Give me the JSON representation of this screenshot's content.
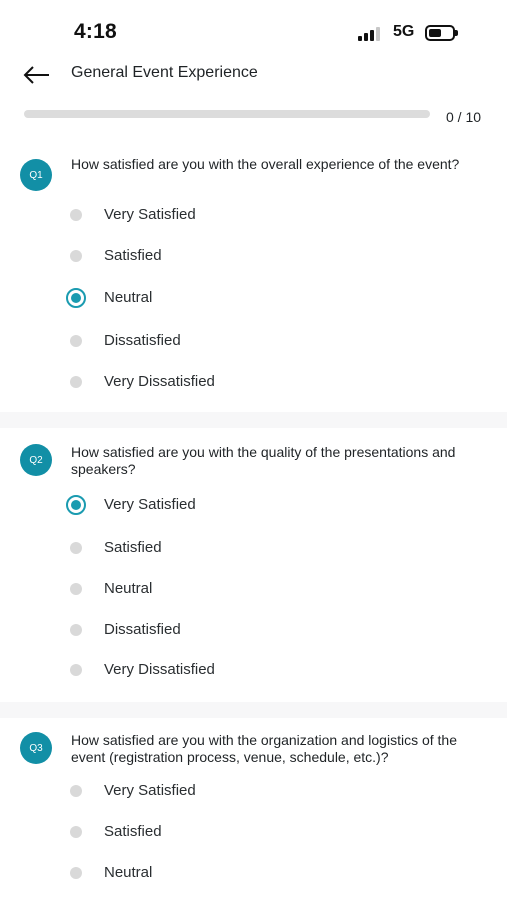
{
  "status_bar": {
    "time": "4:18",
    "network": "5G",
    "signal_icon": "signal-bars-icon",
    "battery_icon": "battery-icon"
  },
  "header": {
    "back_icon": "arrow-left-icon",
    "title": "General Event Experience"
  },
  "progress": {
    "text": "0 / 10",
    "fraction": 0.0
  },
  "colors": {
    "accent": "#128fa6",
    "radio_selected": "#1a9bb0",
    "radio_unselected": "#d9d9d9",
    "progress_track": "#dcdcdc",
    "text": "#1f2326"
  },
  "questions": [
    {
      "badge": "Q1",
      "text": "How satisfied are you with the overall experience of the event?",
      "options": [
        {
          "label": "Very Satisfied",
          "selected": false
        },
        {
          "label": "Satisfied",
          "selected": false
        },
        {
          "label": "Neutral",
          "selected": true
        },
        {
          "label": "Dissatisfied",
          "selected": false
        },
        {
          "label": "Very Dissatisfied",
          "selected": false
        }
      ]
    },
    {
      "badge": "Q2",
      "text": "How satisfied are you with the quality of the presentations and speakers?",
      "options": [
        {
          "label": "Very Satisfied",
          "selected": true
        },
        {
          "label": "Satisfied",
          "selected": false
        },
        {
          "label": "Neutral",
          "selected": false
        },
        {
          "label": "Dissatisfied",
          "selected": false
        },
        {
          "label": "Very Dissatisfied",
          "selected": false
        }
      ]
    },
    {
      "badge": "Q3",
      "text": "How satisfied are you with the organization and logistics of the event (registration process, venue, schedule, etc.)?",
      "options": [
        {
          "label": "Very Satisfied",
          "selected": false
        },
        {
          "label": "Satisfied",
          "selected": false
        },
        {
          "label": "Neutral",
          "selected": false
        }
      ]
    }
  ]
}
